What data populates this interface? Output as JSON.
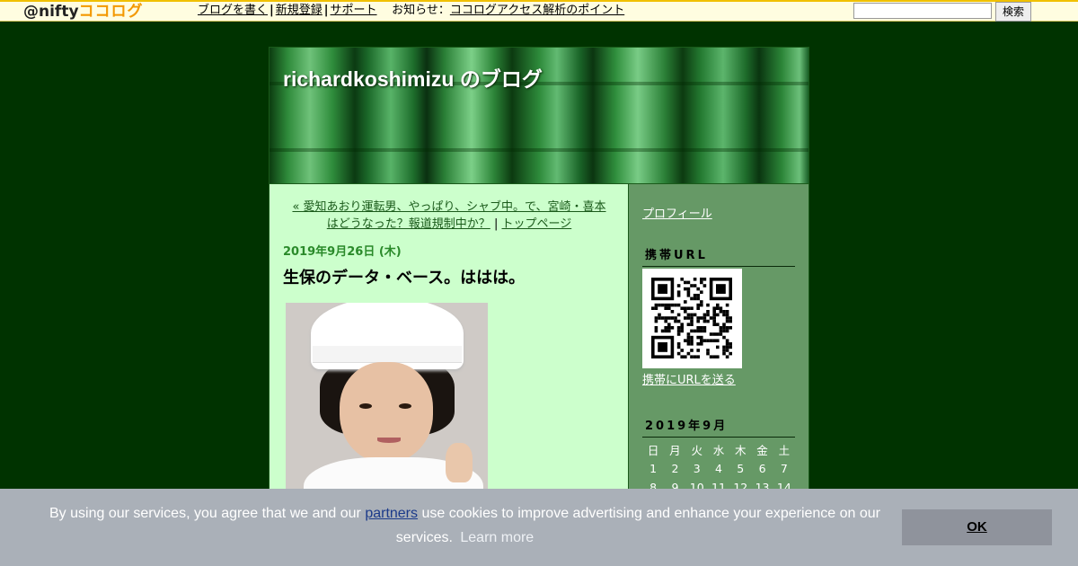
{
  "topbar": {
    "logo_at": "@nifty",
    "logo_brand": "ココログ",
    "links": [
      "ブログを書く",
      "新規登録",
      "サポート"
    ],
    "notice_label": "お知らせ",
    "notice_link": "ココログアクセス解析のポイント",
    "search_value": "",
    "search_button": "検索"
  },
  "blog": {
    "title": "richardkoshimizu のブログ"
  },
  "post": {
    "prev_link": "« 愛知あおり運転男、やっぱり、シャブ中。で、宮崎・喜本はどうなった？報道規制中か？",
    "separator": "|",
    "top_link": "トップページ",
    "date": "2019年9月26日 (木)",
    "title": "生保のデータ・ベース。ははは。"
  },
  "sidebar": {
    "profile": "プロフィール",
    "mobile_heading": "携帯URL",
    "send_url": "携帯にURLを送る",
    "calendar_heading": "2019年9月",
    "weekdays": [
      "日",
      "月",
      "火",
      "水",
      "木",
      "金",
      "土"
    ],
    "weeks": [
      [
        "1",
        "2",
        "3",
        "4",
        "5",
        "6",
        "7"
      ],
      [
        "8",
        "9",
        "10",
        "11",
        "12",
        "13",
        "14"
      ]
    ]
  },
  "cookie": {
    "text_before": "By using our services, you agree that we and our",
    "partners": "partners",
    "text_after": "use cookies to improve advertising and enhance your experience on our services.",
    "learn_more": "Learn more",
    "ok": "OK"
  }
}
